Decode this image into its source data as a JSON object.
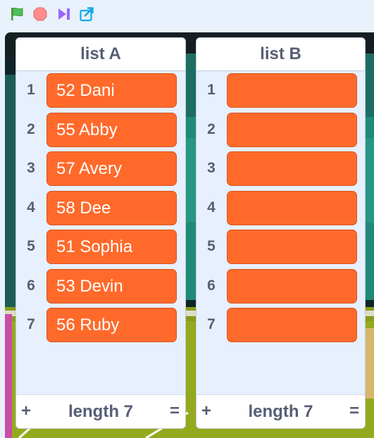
{
  "toolbar": {
    "icons": [
      "green-flag-icon",
      "stop-icon",
      "step-icon",
      "share-icon"
    ],
    "colors": {
      "flag": "#4cbf56",
      "stop": "#ff8c8c",
      "step": "#9966ff",
      "share": "#0fa8e8"
    }
  },
  "lists": [
    {
      "title": "list A",
      "items": [
        {
          "index": "1",
          "value": "52 Dani"
        },
        {
          "index": "2",
          "value": "55 Abby"
        },
        {
          "index": "3",
          "value": "57 Avery"
        },
        {
          "index": "4",
          "value": "58 Dee"
        },
        {
          "index": "5",
          "value": "51 Sophia"
        },
        {
          "index": "6",
          "value": "53 Devin"
        },
        {
          "index": "7",
          "value": "56 Ruby"
        }
      ],
      "add_label": "+",
      "length_label": "length 7",
      "resize_label": "="
    },
    {
      "title": "list B",
      "items": [
        {
          "index": "1",
          "value": ""
        },
        {
          "index": "2",
          "value": ""
        },
        {
          "index": "3",
          "value": ""
        },
        {
          "index": "4",
          "value": ""
        },
        {
          "index": "5",
          "value": ""
        },
        {
          "index": "6",
          "value": ""
        },
        {
          "index": "7",
          "value": ""
        }
      ],
      "add_label": "+",
      "length_label": "length 7",
      "resize_label": "="
    }
  ],
  "colors": {
    "cell": "#ff6a2b",
    "monitor_bg": "#e6f0ff",
    "label": "#575e75"
  }
}
